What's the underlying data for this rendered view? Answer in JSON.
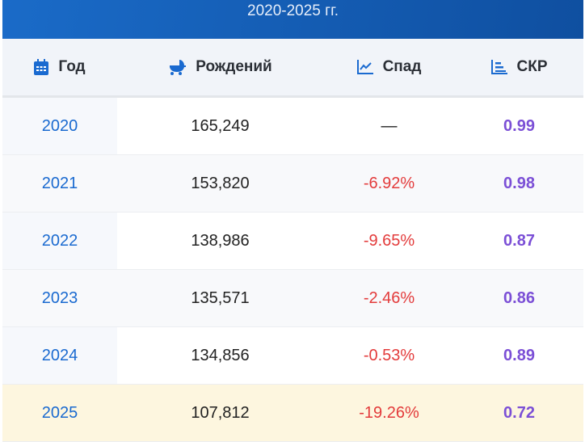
{
  "banner": {
    "title": "2020-2025 гг."
  },
  "headers": {
    "year": "Год",
    "births": "Рождений",
    "decline": "Спад",
    "tfr": "СКР"
  },
  "icons": {
    "year": "calendar-icon",
    "births": "baby-carriage-icon",
    "decline": "line-chart-icon",
    "tfr": "bar-chart-icon"
  },
  "colors": {
    "accent": "#1a6ad0",
    "decline": "#e33b3b",
    "tfr": "#7b4fd6",
    "highlight": "#fdf6df"
  },
  "rows": [
    {
      "year": "2020",
      "births": "165,249",
      "decline": "—",
      "tfr": "0.99"
    },
    {
      "year": "2021",
      "births": "153,820",
      "decline": "-6.92%",
      "tfr": "0.98"
    },
    {
      "year": "2022",
      "births": "138,986",
      "decline": "-9.65%",
      "tfr": "0.87"
    },
    {
      "year": "2023",
      "births": "135,571",
      "decline": "-2.46%",
      "tfr": "0.86"
    },
    {
      "year": "2024",
      "births": "134,856",
      "decline": "-0.53%",
      "tfr": "0.89"
    },
    {
      "year": "2025",
      "births": "107,812",
      "decline": "-19.26%",
      "tfr": "0.72"
    }
  ]
}
